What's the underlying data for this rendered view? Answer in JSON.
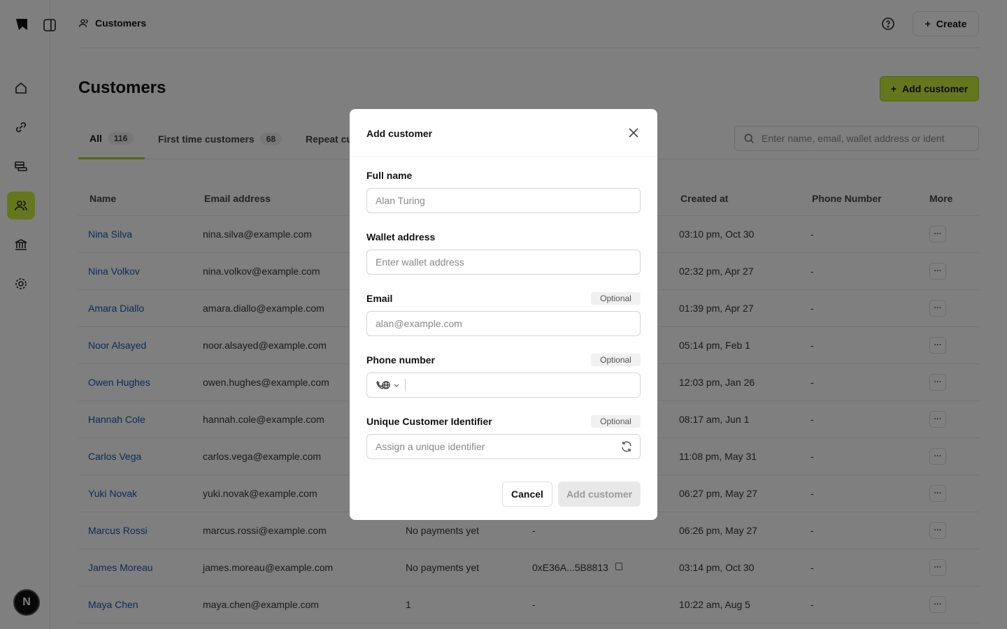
{
  "breadcrumb": {
    "label": "Customers"
  },
  "header": {
    "create_label": "Create"
  },
  "page": {
    "title": "Customers",
    "add_button": "Add customer"
  },
  "tabs": [
    {
      "label": "All",
      "count": "116"
    },
    {
      "label": "First time customers",
      "count": "68"
    },
    {
      "label": "Repeat cu"
    }
  ],
  "search": {
    "placeholder": "Enter name, email, wallet address or ident"
  },
  "table": {
    "headers": {
      "name": "Name",
      "email": "Email address",
      "created": "Created at",
      "phone": "Phone Number",
      "more": "More"
    },
    "rows": [
      {
        "name": "Nina Silva",
        "email": "nina.silva@example.com",
        "payments": "",
        "wallet": "",
        "created": "03:10 pm, Oct 30",
        "phone": "-"
      },
      {
        "name": "Nina Volkov",
        "email": "nina.volkov@example.com",
        "payments": "",
        "wallet": "",
        "created": "02:32 pm, Apr 27",
        "phone": "-"
      },
      {
        "name": "Amara Diallo",
        "email": "amara.diallo@example.com",
        "payments": "",
        "wallet": "",
        "created": "01:39 pm, Apr 27",
        "phone": "-"
      },
      {
        "name": "Noor Alsayed",
        "email": "noor.alsayed@example.com",
        "payments": "",
        "wallet": "",
        "created": "05:14 pm, Feb 1",
        "phone": "-"
      },
      {
        "name": "Owen Hughes",
        "email": "owen.hughes@example.com",
        "payments": "",
        "wallet": "",
        "created": "12:03 pm, Jan 26",
        "phone": "-"
      },
      {
        "name": "Hannah Cole",
        "email": "hannah.cole@example.com",
        "payments": "",
        "wallet": "",
        "created": "08:17 am, Jun 1",
        "phone": "-"
      },
      {
        "name": "Carlos Vega",
        "email": "carlos.vega@example.com",
        "payments": "",
        "wallet": "",
        "created": "11:08 pm, May 31",
        "phone": "-"
      },
      {
        "name": "Yuki Novak",
        "email": "yuki.novak@example.com",
        "payments": "",
        "wallet": "",
        "created": "06:27 pm, May 27",
        "phone": "-"
      },
      {
        "name": "Marcus Rossi",
        "email": "marcus.rossi@example.com",
        "payments": "No payments yet",
        "wallet": "-",
        "created": "06:26 pm, May 27",
        "phone": "-"
      },
      {
        "name": "James Moreau",
        "email": "james.moreau@example.com",
        "payments": "No payments yet",
        "wallet": "0xE36A...5B8813",
        "created": "03:14 pm, Oct 30",
        "phone": "-"
      },
      {
        "name": "Maya Chen",
        "email": "maya.chen@example.com",
        "payments": "1",
        "wallet": "-",
        "created": "10:22 am, Aug 5",
        "phone": "-"
      }
    ]
  },
  "user": {
    "initial": "N"
  },
  "modal": {
    "title": "Add customer",
    "optional_label": "Optional",
    "full_name": {
      "label": "Full name",
      "placeholder": "Alan Turing"
    },
    "wallet": {
      "label": "Wallet address",
      "placeholder": "Enter wallet address"
    },
    "email": {
      "label": "Email",
      "placeholder": "alan@example.com"
    },
    "phone": {
      "label": "Phone number"
    },
    "identifier": {
      "label": "Unique Customer Identifier",
      "placeholder": "Assign a unique identifier"
    },
    "cancel": "Cancel",
    "submit": "Add customer"
  }
}
